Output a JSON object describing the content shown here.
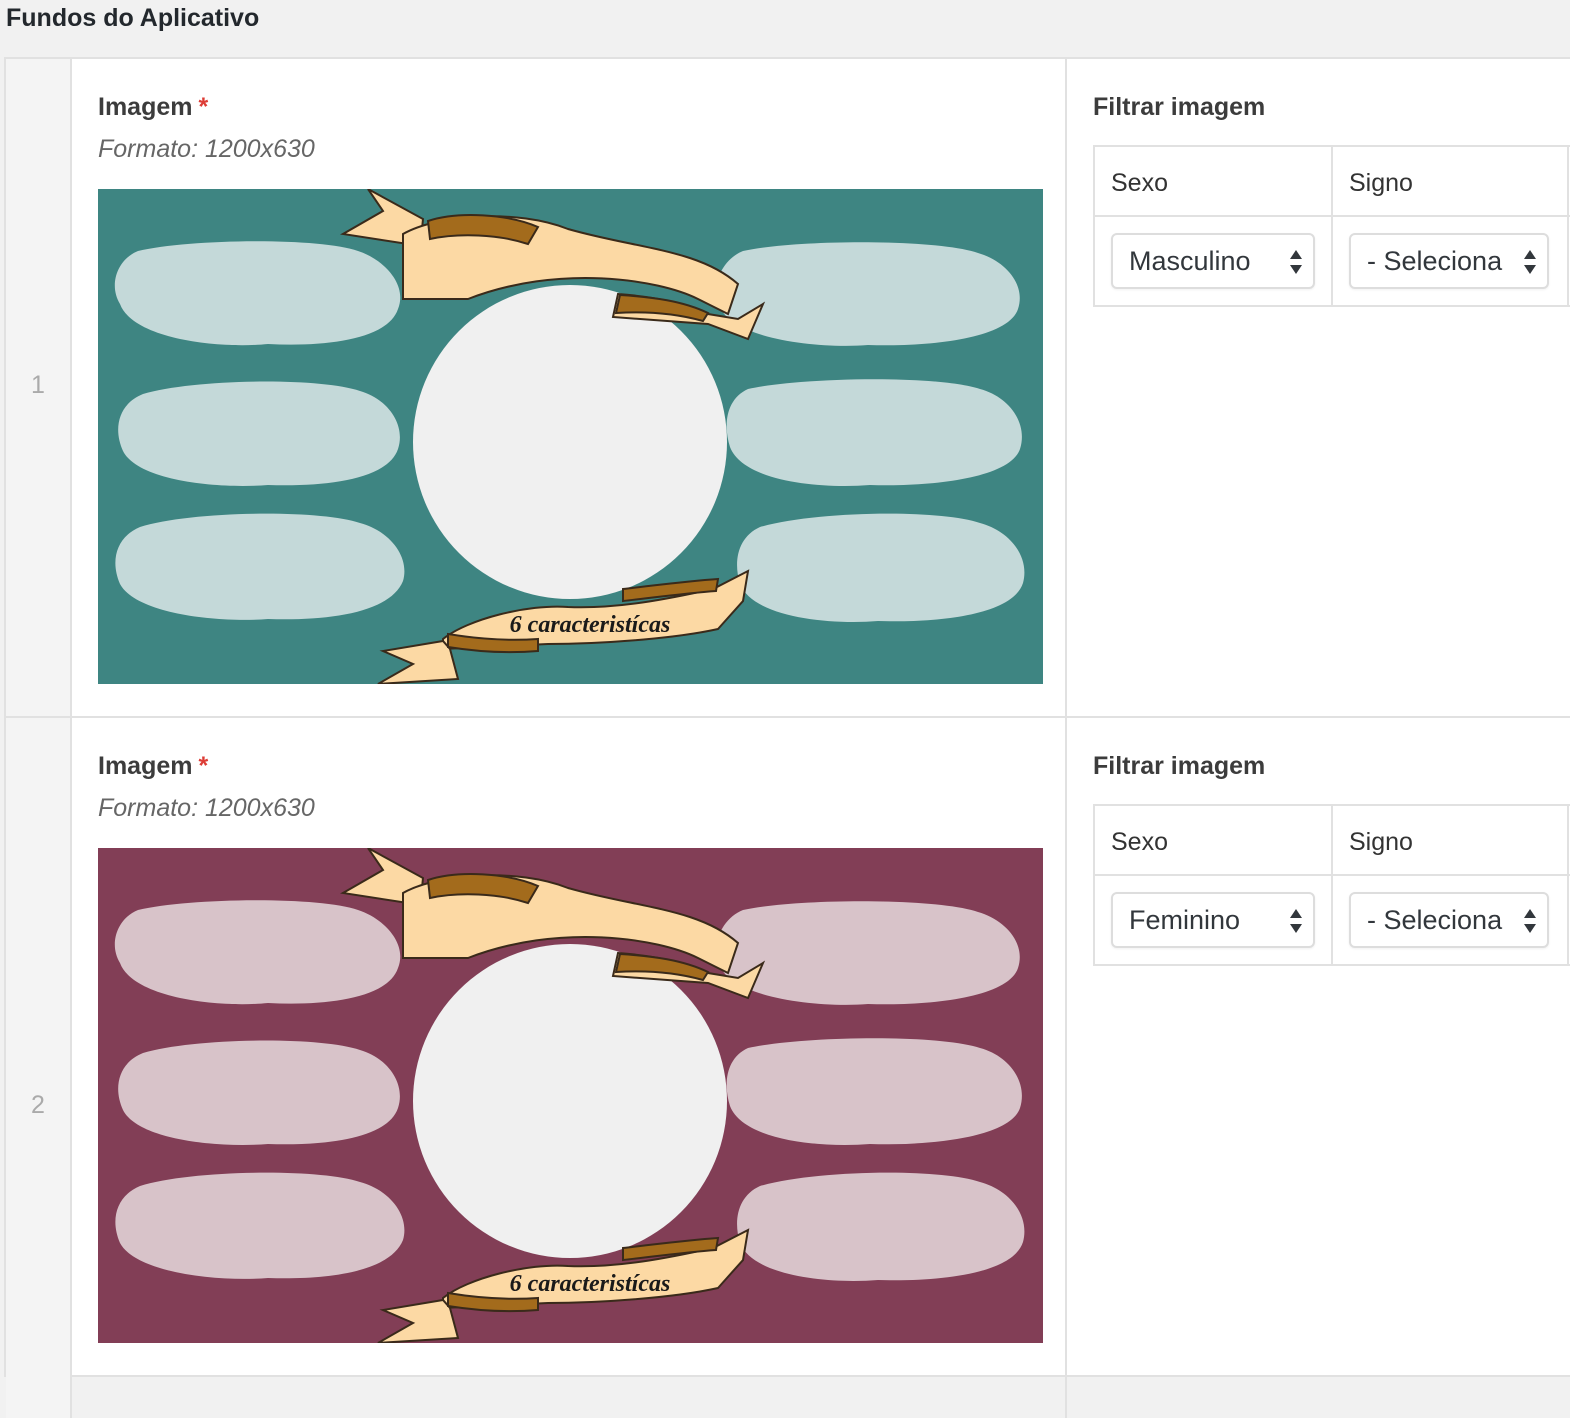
{
  "section": {
    "title": "Fundos do Aplicativo"
  },
  "rows": [
    {
      "index": "1",
      "image": {
        "label": "Imagem",
        "required_mark": "*",
        "instructions": "Formato: 1200x630",
        "preview_text": "6 caracteristícas",
        "background_color": "#3e8582",
        "bubble_color": "#c4d9d9"
      },
      "filter": {
        "label": "Filtrar imagem",
        "columns": [
          "Sexo",
          "Signo"
        ],
        "sexo_value": "Masculino",
        "signo_value": "- Seleciona"
      }
    },
    {
      "index": "2",
      "image": {
        "label": "Imagem",
        "required_mark": "*",
        "instructions": "Formato: 1200x630",
        "preview_text": "6 caracteristícas",
        "background_color": "#823e56",
        "bubble_color": "#d8c3c9"
      },
      "filter": {
        "label": "Filtrar imagem",
        "columns": [
          "Sexo",
          "Signo"
        ],
        "sexo_value": "Feminino",
        "signo_value": "- Seleciona"
      }
    }
  ],
  "icons": {
    "select_arrows": "updown-arrows-icon"
  }
}
